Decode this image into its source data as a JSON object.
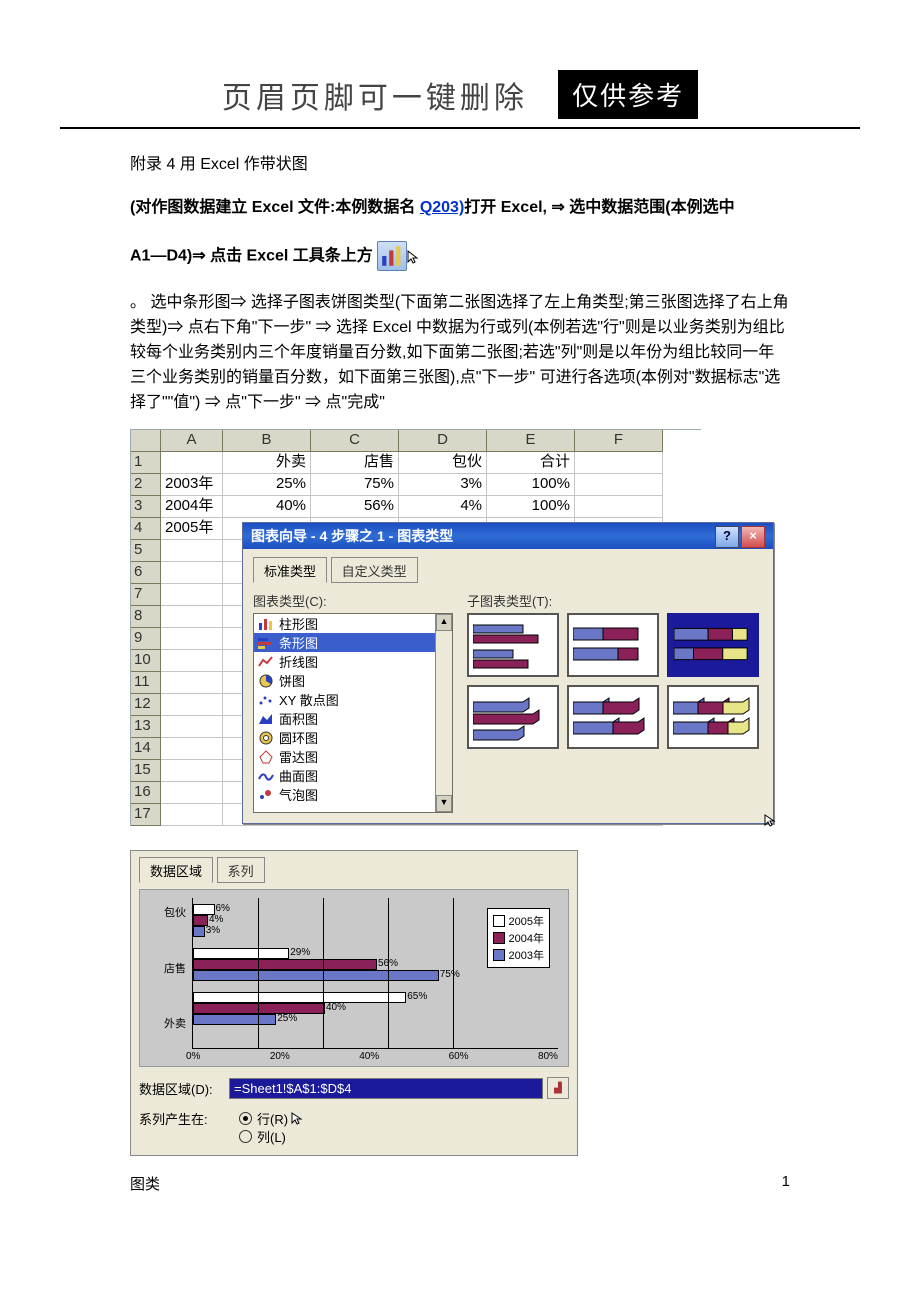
{
  "header": {
    "title": "页眉页脚可一键删除",
    "badge": "仅供参考"
  },
  "text": {
    "line1": "附录 4 用 Excel 作带状图",
    "bold1_a": "(对作图数据建立 Excel 文件:本例数据名 ",
    "link_q203": "Q203)",
    "bold1_b": "打开 Excel, ⇒ 选中数据范围(本例选中",
    "bold2": "A1—D4)⇒ 点击 Excel 工具条上方",
    "para2": "。 选中条形图⇒ 选择子图表饼图类型(下面第二张图选择了左上角类型;第三张图选择了右上角类型)⇒ 点右下角\"下一步\" ⇒ 选择 Excel 中数据为行或列(本例若选\"行\"则是以业务类别为组比较每个业务类别内三个年度销量百分数,如下面第二张图;若选\"列\"则是以年份为组比较同一年三个业务类别的销量百分数，如下面第三张图),点\"下一步\" 可进行各选项(本例对\"数据标志\"选择了\"\"值\") ⇒ 点\"下一步\" ⇒ 点\"完成\""
  },
  "spreadsheet": {
    "cols": [
      "",
      "A",
      "B",
      "C",
      "D",
      "E",
      "F"
    ],
    "rows": [
      {
        "n": "1",
        "cells": [
          "",
          "外卖",
          "店售",
          "包伙",
          "合计",
          ""
        ]
      },
      {
        "n": "2",
        "cells": [
          "2003年",
          "25%",
          "75%",
          "3%",
          "100%",
          ""
        ]
      },
      {
        "n": "3",
        "cells": [
          "2004年",
          "40%",
          "56%",
          "4%",
          "100%",
          ""
        ]
      },
      {
        "n": "4",
        "cells": [
          "2005年",
          "",
          "",
          "",
          "",
          ""
        ]
      },
      {
        "n": "5",
        "cells": [
          "",
          "",
          "",
          "",
          "",
          ""
        ]
      },
      {
        "n": "6",
        "cells": [
          "",
          "",
          "",
          "",
          "",
          ""
        ]
      },
      {
        "n": "7",
        "cells": [
          "",
          "",
          "",
          "",
          "",
          ""
        ]
      },
      {
        "n": "8",
        "cells": [
          "",
          "",
          "",
          "",
          "",
          ""
        ]
      },
      {
        "n": "9",
        "cells": [
          "",
          "",
          "",
          "",
          "",
          ""
        ]
      },
      {
        "n": "10",
        "cells": [
          "",
          "",
          "",
          "",
          "",
          ""
        ]
      },
      {
        "n": "11",
        "cells": [
          "",
          "",
          "",
          "",
          "",
          ""
        ]
      },
      {
        "n": "12",
        "cells": [
          "",
          "",
          "",
          "",
          "",
          ""
        ]
      },
      {
        "n": "13",
        "cells": [
          "",
          "",
          "",
          "",
          "",
          ""
        ]
      },
      {
        "n": "14",
        "cells": [
          "",
          "",
          "",
          "",
          "",
          ""
        ]
      },
      {
        "n": "15",
        "cells": [
          "",
          "",
          "",
          "",
          "",
          ""
        ]
      },
      {
        "n": "16",
        "cells": [
          "",
          "",
          "",
          "",
          "",
          ""
        ]
      },
      {
        "n": "17",
        "cells": [
          "",
          "",
          "",
          "",
          "",
          ""
        ]
      }
    ]
  },
  "wizard": {
    "title": "图表向导 - 4 步骤之 1 - 图表类型",
    "tab_std": "标准类型",
    "tab_custom": "自定义类型",
    "label_type": "图表类型(C):",
    "label_sub": "子图表类型(T):",
    "types": [
      "柱形图",
      "条形图",
      "折线图",
      "饼图",
      "XY 散点图",
      "面积图",
      "圆环图",
      "雷达图",
      "曲面图",
      "气泡图"
    ],
    "selected_idx": 1
  },
  "step2": {
    "tab_range": "数据区域",
    "tab_series": "系列",
    "label_range": "数据区域(D):",
    "range_val": "=Sheet1!$A$1:$D$4",
    "label_axis_src": "系列产生在:",
    "radio_row": "行(R)",
    "radio_col": "列(L)"
  },
  "chart_data": {
    "type": "bar",
    "orientation": "horizontal",
    "categories": [
      "外卖",
      "店售",
      "包伙"
    ],
    "series": [
      {
        "name": "2005年",
        "color": "#ffffff",
        "values": [
          65,
          29,
          6
        ]
      },
      {
        "name": "2004年",
        "color": "#8a2158",
        "values": [
          40,
          56,
          4
        ]
      },
      {
        "name": "2003年",
        "color": "#6a77c7",
        "values": [
          25,
          75,
          3
        ]
      }
    ],
    "xlim": [
      0,
      80
    ],
    "xticks": [
      "0%",
      "20%",
      "40%",
      "60%",
      "80%"
    ],
    "legend": [
      "2005年",
      "2004年",
      "2003年"
    ]
  },
  "footer": {
    "left": "图类",
    "right": "1"
  }
}
